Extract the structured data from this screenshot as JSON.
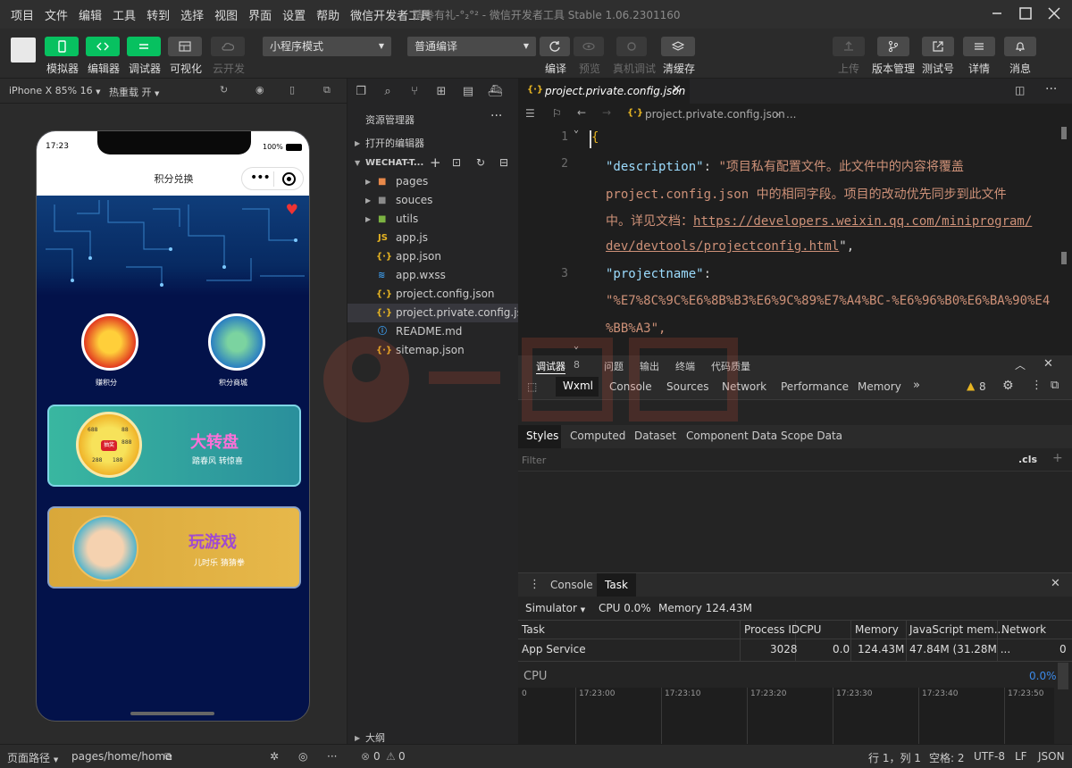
{
  "menubar": {
    "items": [
      "项目",
      "文件",
      "编辑",
      "工具",
      "转到",
      "选择",
      "视图",
      "界面",
      "设置",
      "帮助",
      "微信开发者工具"
    ],
    "title": "猜拳有礼-°₂°² - 微信开发者工具 Stable 1.06.2301160"
  },
  "toolbar": {
    "buttons": [
      "模拟器",
      "编辑器",
      "调试器",
      "可视化",
      "云开发"
    ],
    "mode_select": "小程序模式",
    "compile_select": "普通编译",
    "compile_actions": [
      "编译",
      "预览",
      "真机调试",
      "清缓存"
    ],
    "right_actions": [
      "上传",
      "版本管理",
      "测试号",
      "详情",
      "消息"
    ]
  },
  "simbar": {
    "device": "iPhone X 85% 16",
    "hotreload": "热重载 开"
  },
  "phone": {
    "time": "17:23",
    "battery": "100%",
    "nav_title": "积分兑换",
    "icon1_label": "赚积分",
    "icon2_label": "积分商城",
    "card1_title": "大转盘",
    "card1_sub": "踏春风  转惊喜",
    "card2_title": "玩游戏",
    "card2_sub": "儿时乐  猜猜拳",
    "wheel_text": [
      "688",
      "88",
      "888",
      "288",
      "188",
      "抽奖"
    ]
  },
  "explorer": {
    "title": "资源管理器",
    "open_editors": "打开的编辑器",
    "project": "WECHAT-T...",
    "outline": "大纲",
    "items": [
      {
        "name": "pages",
        "type": "folder"
      },
      {
        "name": "souces",
        "type": "folder"
      },
      {
        "name": "utils",
        "type": "folder"
      },
      {
        "name": "app.js",
        "type": "js"
      },
      {
        "name": "app.json",
        "type": "json"
      },
      {
        "name": "app.wxss",
        "type": "css"
      },
      {
        "name": "project.config.json",
        "type": "json"
      },
      {
        "name": "project.private.config.js...",
        "type": "json"
      },
      {
        "name": "README.md",
        "type": "md"
      },
      {
        "name": "sitemap.json",
        "type": "json"
      }
    ]
  },
  "editor": {
    "tab": "project.private.config.json",
    "breadcrumb": "project.private.config.json",
    "breadcrumb_more": "...",
    "line_numbers": [
      "1",
      "2",
      "3"
    ],
    "lines": {
      "l1": "{",
      "l2_key": "\"description\"",
      "l2_val": "\"项目私有配置文件。此文件中的内容将覆盖",
      "l3": "project.config.json 中的相同字段。项目的改动优先同步到此文件",
      "l4_a": "中。详见文档：",
      "l4_link": "https://developers.weixin.qq.com/miniprogram/",
      "l5_link": "dev/devtools/projectconfig.html",
      "l5_end": "\",",
      "l6_key": "\"projectname\"",
      "l7": "\"%E7%8C%9C%E6%8B%B3%E6%9C%89%E7%A4%BC-%E6%96%B0%E6%BA%90%E4",
      "l8": "%BB%A3\","
    }
  },
  "debugger": {
    "tabs": [
      "调试器",
      "问题",
      "输出",
      "终端",
      "代码质量"
    ],
    "badge": "8",
    "devtabs": [
      "Wxml",
      "Console",
      "Sources",
      "Network",
      "Performance",
      "Memory"
    ],
    "warn": "8",
    "style_tabs": [
      "Styles",
      "Computed",
      "Dataset",
      "Component Data",
      "Scope Data"
    ],
    "filter_placeholder": "Filter",
    "cls": ".cls"
  },
  "task": {
    "tabs": [
      "Console",
      "Task"
    ],
    "simulator": "Simulator",
    "cpu": "CPU 0.0%",
    "memory": "Memory 124.43M",
    "headers": [
      "Task",
      "Process ID",
      "CPU",
      "Memory",
      "JavaScript mem...",
      "Network"
    ],
    "row": [
      "App Service",
      "3028",
      "0.0",
      "124.43M",
      "47.84M (31.28M ...",
      "0"
    ],
    "cpu_label": "CPU",
    "cpu_value": "0.0%",
    "ticks": [
      "0",
      "17:23:00",
      "17:23:10",
      "17:23:20",
      "17:23:30",
      "17:23:40",
      "17:23:50"
    ]
  },
  "statusbar": {
    "page_path_label": "页面路径",
    "page_path": "pages/home/home",
    "errors": "0",
    "warnings": "0",
    "cursor": "行 1，列 1",
    "spaces": "空格: 2",
    "encoding": "UTF-8",
    "eol": "LF",
    "lang": "JSON"
  }
}
